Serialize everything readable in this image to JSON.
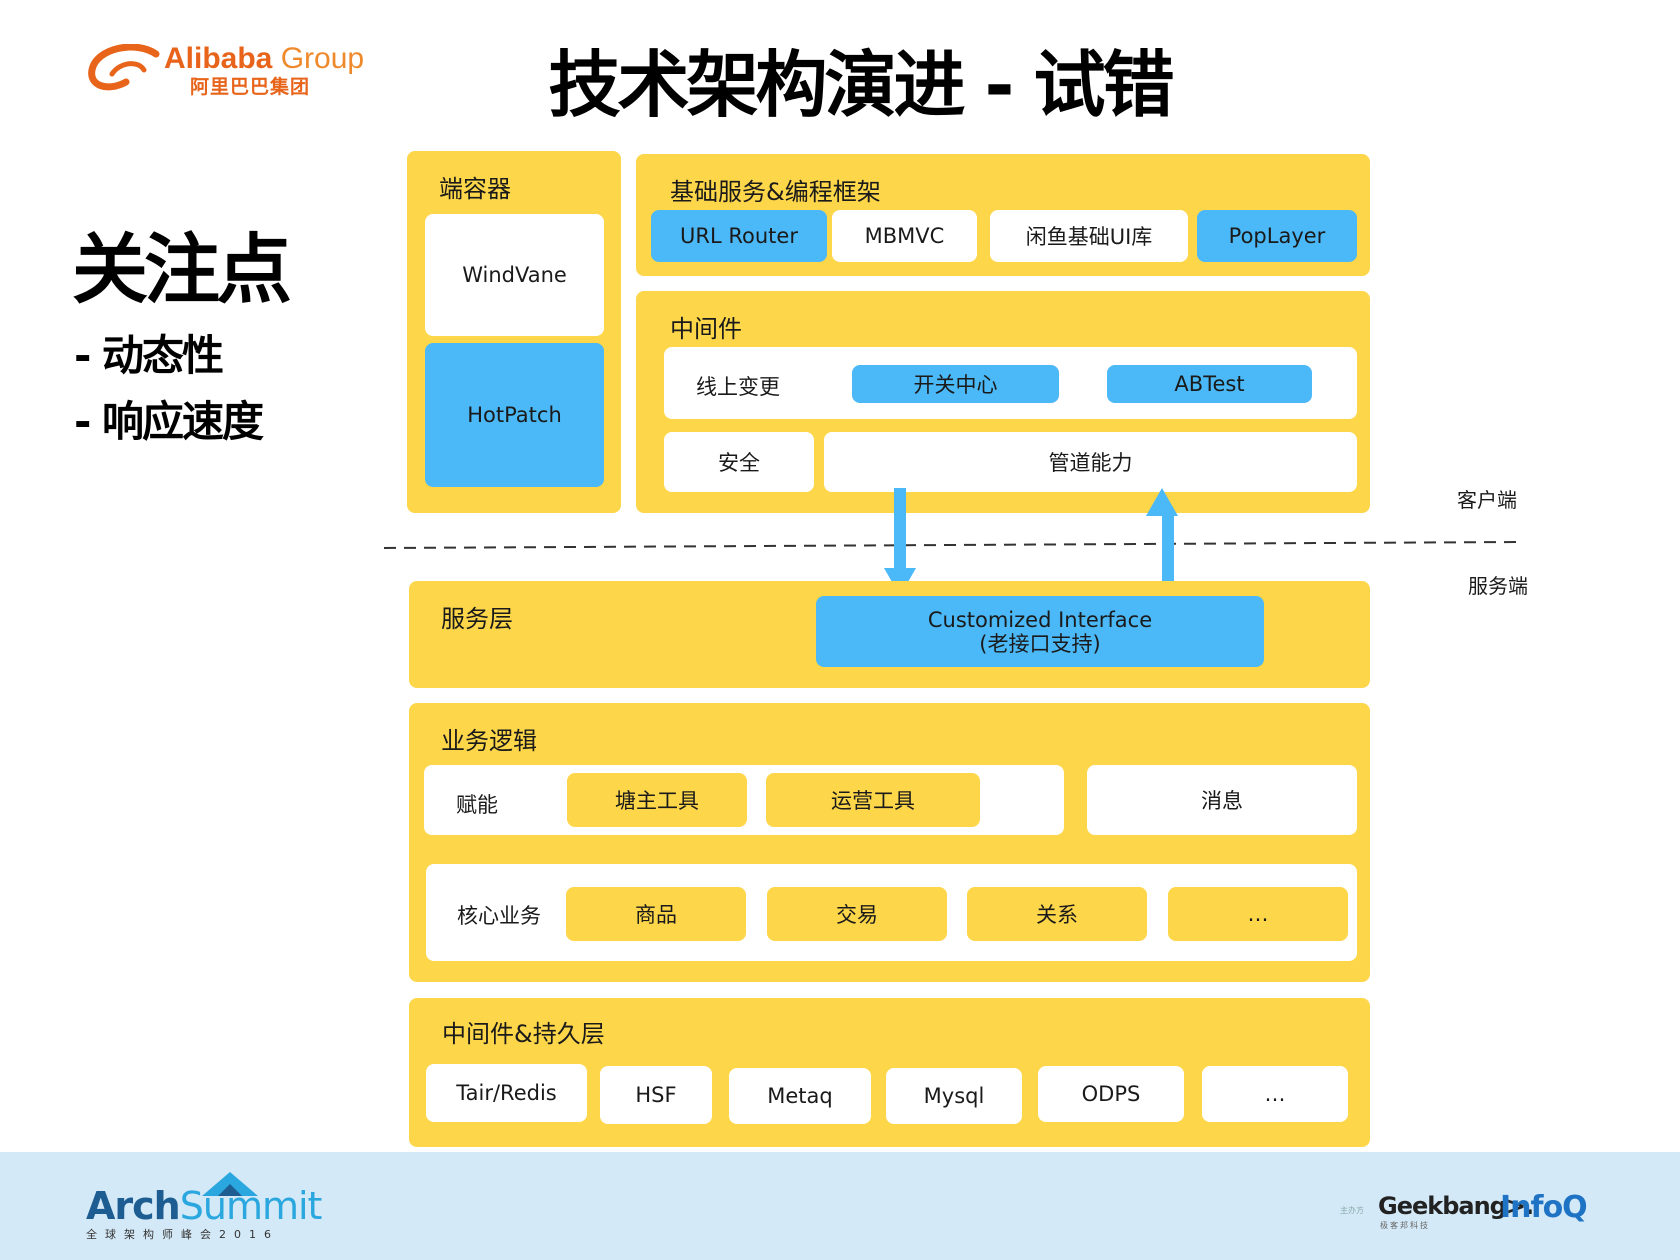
{
  "logo": {
    "brand": "Alibaba",
    "group": "Group",
    "sub": "阿里巴巴集团"
  },
  "title": "技术架构演进 - 试错",
  "focus": {
    "title": "关注点",
    "items": [
      "- 动态性",
      "- 响应速度"
    ]
  },
  "container": {
    "label": "端容器",
    "items": [
      "WindVane",
      "HotPatch"
    ]
  },
  "basic": {
    "label": "基础服务&编程框架",
    "items": [
      "URL Router",
      "MBMVC",
      "闲鱼基础UI库",
      "PopLayer"
    ]
  },
  "middleware": {
    "label": "中间件",
    "online_change": "线上变更",
    "switch_center": "开关中心",
    "abtest": "ABTest",
    "security": "安全",
    "pipeline": "管道能力"
  },
  "sides": {
    "client": "客户端",
    "server": "服务端"
  },
  "service": {
    "label": "服务层",
    "interface_line1": "Customized Interface",
    "interface_line2": "(老接口支持)"
  },
  "business": {
    "label": "业务逻辑",
    "empower": "赋能",
    "pond_tool": "塘主工具",
    "ops_tool": "运营工具",
    "message": "消息",
    "core": "核心业务",
    "core_items": [
      "商品",
      "交易",
      "关系",
      "…"
    ]
  },
  "persistence": {
    "label": "中间件&持久层",
    "items": [
      "Tair/Redis",
      "HSF",
      "Metaq",
      "Mysql",
      "ODPS",
      "…"
    ]
  },
  "footer": {
    "arch": "Arch",
    "summit": "Summit",
    "arch_sub": "全球架构师峰会2016",
    "host": "主办方",
    "geekbang": "Geekbang>.",
    "geekbang_sub": "极客邦科技",
    "infoq": "InfoQ"
  },
  "colors": {
    "panel": "#fdd64a",
    "accent": "#4bb8f7",
    "footer": "#d4e9f7"
  }
}
